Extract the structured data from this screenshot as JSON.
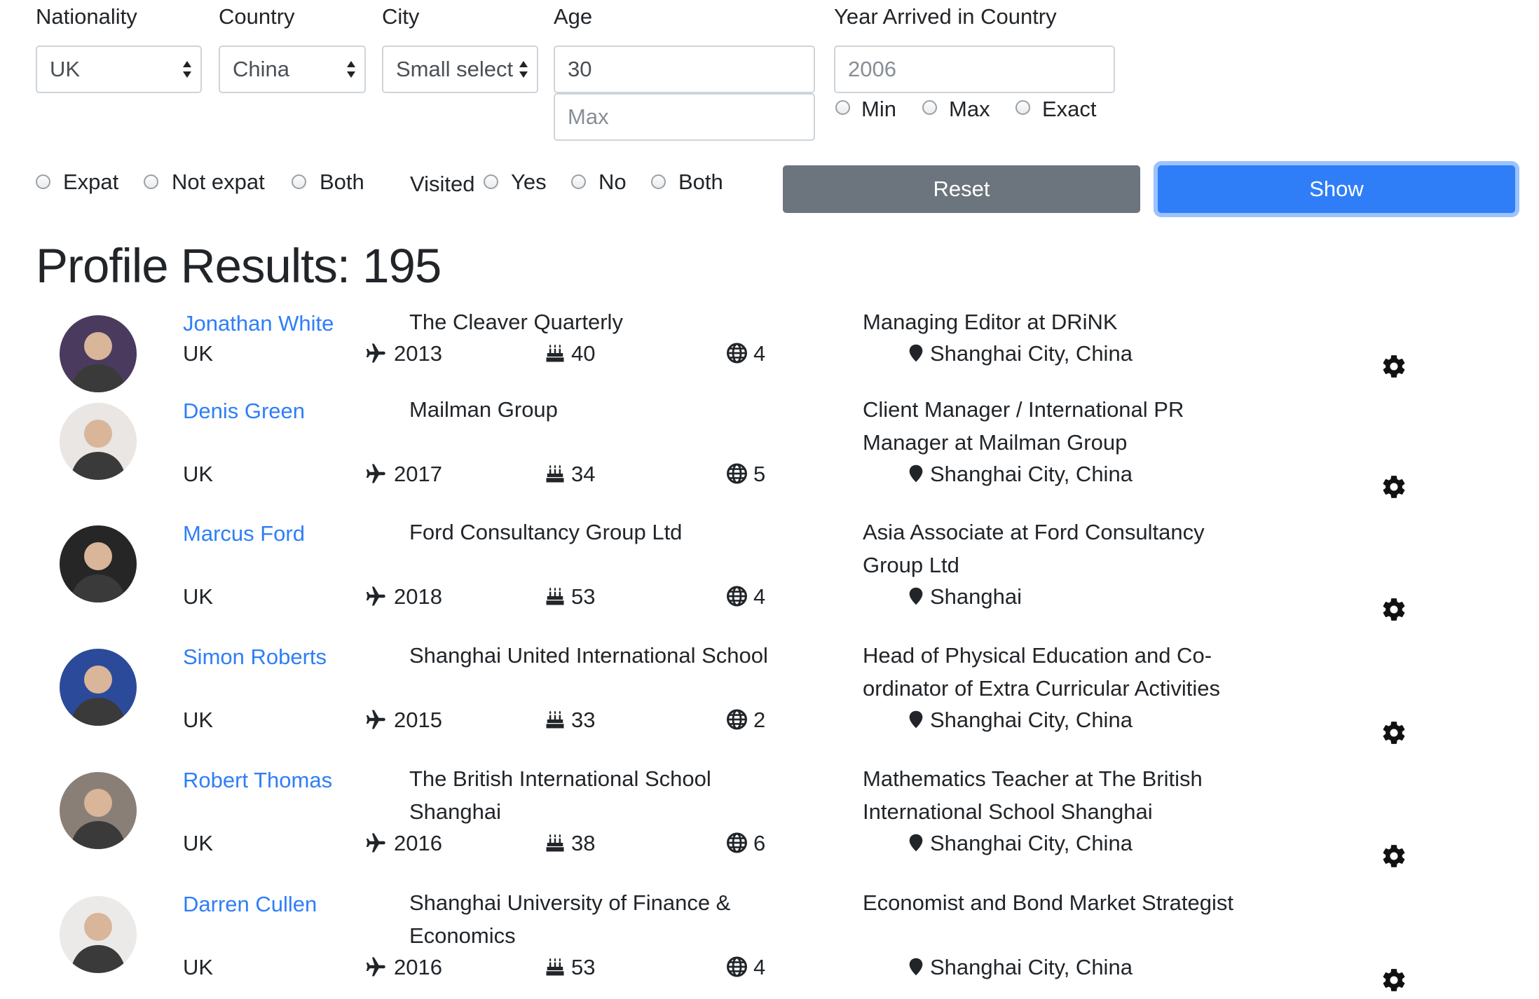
{
  "filters": {
    "nationality": {
      "label": "Nationality",
      "value": "UK"
    },
    "country": {
      "label": "Country",
      "value": "China"
    },
    "city": {
      "label": "City",
      "value": "Small select"
    },
    "age": {
      "label": "Age",
      "min_value": "30",
      "max_placeholder": "Max"
    },
    "year_arrived": {
      "label": "Year Arrived in Country",
      "placeholder": "2006",
      "options": [
        "Min",
        "Max",
        "Exact"
      ]
    },
    "expat_options": [
      "Expat",
      "Not expat",
      "Both"
    ],
    "visited": {
      "label": "Visited",
      "options": [
        "Yes",
        "No",
        "Both"
      ]
    },
    "reset_label": "Reset",
    "show_label": "Show"
  },
  "results": {
    "title": "Profile Results: 195",
    "profiles": [
      {
        "name": "Jonathan White",
        "nationality": "UK",
        "company": "The Cleaver Quarterly",
        "year": "2013",
        "age": "40",
        "countries": "4",
        "position": "Managing Editor at DRiNK",
        "location": "Shanghai City, China",
        "avatar_color": "#4a3a5e"
      },
      {
        "name": "Denis Green",
        "nationality": "UK",
        "company": "Mailman Group",
        "year": "2017",
        "age": "34",
        "countries": "5",
        "position": "Client Manager / International PR Manager at Mailman Group",
        "location": "Shanghai City, China",
        "avatar_color": "#e9e6e3"
      },
      {
        "name": "Marcus Ford",
        "nationality": "UK",
        "company": "Ford Consultancy Group Ltd",
        "year": "2018",
        "age": "53",
        "countries": "4",
        "position": "Asia Associate at Ford Consultancy Group Ltd",
        "location": "Shanghai",
        "avatar_color": "#262626"
      },
      {
        "name": "Simon Roberts",
        "nationality": "UK",
        "company": "Shanghai United International School",
        "year": "2015",
        "age": "33",
        "countries": "2",
        "position": "Head of Physical Education and Co-ordinator of Extra Curricular Activities",
        "location": "Shanghai City, China",
        "avatar_color": "#2c4a9a"
      },
      {
        "name": "Robert Thomas",
        "nationality": "UK",
        "company": "The British International School Shanghai",
        "year": "2016",
        "age": "38",
        "countries": "6",
        "position": "Mathematics Teacher at The British International School Shanghai",
        "location": "Shanghai City, China",
        "avatar_color": "#8a7f77"
      },
      {
        "name": "Darren Cullen",
        "nationality": "UK",
        "company": "Shanghai University of Finance & Economics",
        "year": "2016",
        "age": "53",
        "countries": "4",
        "position": "Economist and Bond Market Strategist",
        "location": "Shanghai City, China",
        "avatar_color": "#eceae8"
      }
    ]
  },
  "icons": {
    "plane": "plane-icon",
    "cake": "birthday-cake-icon",
    "globe": "globe-icon",
    "pin": "map-marker-icon",
    "gear": "gear-icon"
  }
}
